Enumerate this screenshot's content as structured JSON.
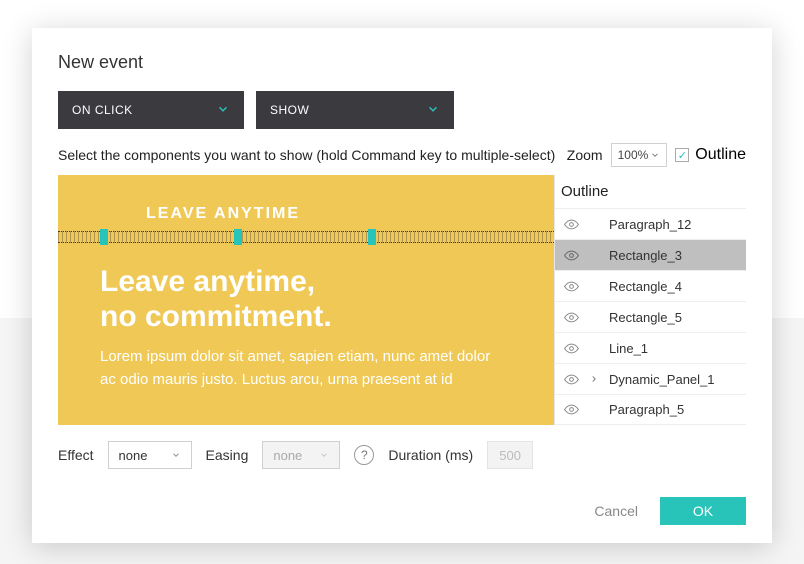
{
  "title": "New event",
  "dropdowns": {
    "trigger": "ON CLICK",
    "action": "SHOW"
  },
  "instruction": "Select the components you want to show (hold Command key to multiple-select)",
  "zoom": {
    "label": "Zoom",
    "value": "100%"
  },
  "outline_toggle": {
    "label": "Outline",
    "checked": true
  },
  "canvas": {
    "smalltitle": "LEAVE ANYTIME",
    "headline_line1": "Leave anytime,",
    "headline_line2": "no commitment.",
    "body": "Lorem ipsum dolor sit amet, sapien etiam, nunc amet dolor ac odio mauris justo. Luctus arcu, urna praesent at id"
  },
  "outline_panel": {
    "header": "Outline",
    "items": [
      {
        "label": "Paragraph_12",
        "selected": false,
        "expandable": false
      },
      {
        "label": "Rectangle_3",
        "selected": true,
        "expandable": false
      },
      {
        "label": "Rectangle_4",
        "selected": false,
        "expandable": false
      },
      {
        "label": "Rectangle_5",
        "selected": false,
        "expandable": false
      },
      {
        "label": "Line_1",
        "selected": false,
        "expandable": false
      },
      {
        "label": "Dynamic_Panel_1",
        "selected": false,
        "expandable": true
      },
      {
        "label": "Paragraph_5",
        "selected": false,
        "expandable": false
      }
    ]
  },
  "effects": {
    "effect_label": "Effect",
    "effect_value": "none",
    "easing_label": "Easing",
    "easing_value": "none",
    "duration_label": "Duration (ms)",
    "duration_value": "500"
  },
  "footer": {
    "cancel": "Cancel",
    "ok": "OK"
  },
  "colors": {
    "accent": "#28c4ba",
    "canvas_bg": "#efc856",
    "dark": "#3a3a3f"
  }
}
